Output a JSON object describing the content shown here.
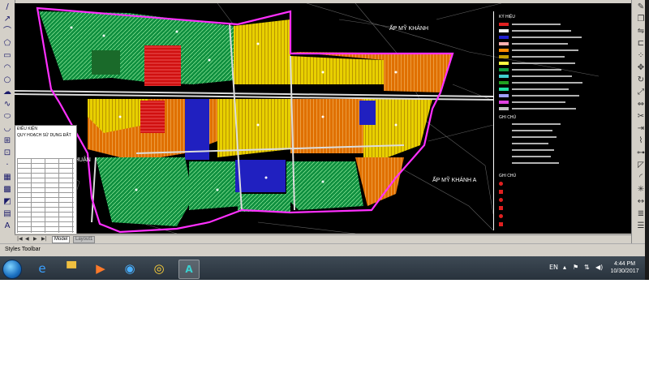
{
  "canvas": {
    "labels": {
      "area_west": "ẤP BÌNH THUẬN",
      "area_northeast": "ẤP MỸ KHÁNH",
      "area_east": "ẤP MỸ KHÁNH A"
    }
  },
  "properties_table": {
    "title": "ĐIỀU KIỆN",
    "subtitle": "QUY HOẠCH SỬ DỤNG ĐẤT"
  },
  "legend": {
    "title": "KÝ HIỆU",
    "section2": "GHI CHÚ",
    "section3": "GHI CHÚ",
    "swatches": [
      "#e02020",
      "#f0f0f0",
      "#2020d0",
      "#ffb0b0",
      "#ff8a00",
      "#c8a000",
      "#ffff40",
      "#10a040",
      "#40d0d0",
      "#20a020",
      "#20e0a0",
      "#a0a0ff",
      "#e040e0",
      "#c0c0c0"
    ]
  },
  "layout_tabs": {
    "nav": [
      "|◀",
      "◀",
      "▶",
      "▶|"
    ],
    "tabs": [
      "Model",
      "Layout1"
    ]
  },
  "statusbar": {
    "text": "Styles Toolbar"
  },
  "taskbar": {
    "pinned_icons": [
      "internet-explorer-icon",
      "file-explorer-icon",
      "media-player-icon",
      "network-icon",
      "chrome-icon",
      "autocad-icon"
    ],
    "tray": {
      "language": "EN"
    },
    "clock": {
      "time": "4:44 PM",
      "date": "10/30/2017"
    }
  }
}
